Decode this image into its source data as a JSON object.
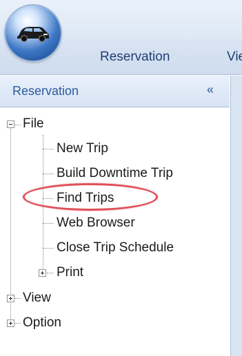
{
  "ribbon": {
    "app_icon": "car-icon",
    "tabs": [
      {
        "label": "Reservation"
      },
      {
        "label": "View"
      }
    ]
  },
  "nav_pane": {
    "title": "Reservation",
    "collapse_label": "«"
  },
  "tree": {
    "file": {
      "label": "File",
      "children": [
        {
          "label": "New Trip"
        },
        {
          "label": "Build Downtime Trip"
        },
        {
          "label": "Find Trips"
        },
        {
          "label": "Web Browser"
        },
        {
          "label": "Close Trip Schedule"
        },
        {
          "label": "Print"
        }
      ]
    },
    "view": {
      "label": "View"
    },
    "option": {
      "label": "Option"
    }
  },
  "colors": {
    "ribbon_text": "#1e3f72",
    "nav_title": "#2c5aa0",
    "highlight": "#e0505a"
  }
}
